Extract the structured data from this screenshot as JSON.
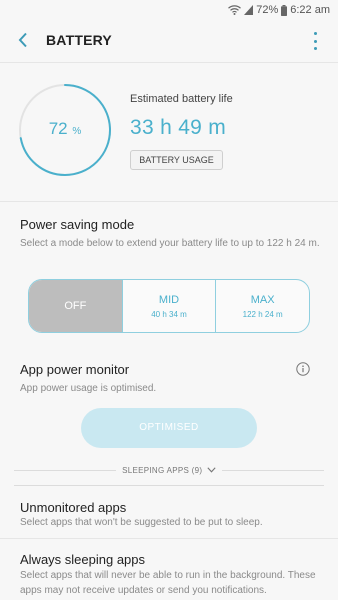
{
  "status_bar": {
    "battery_percent": "72%",
    "time": "6:22 am"
  },
  "app_bar": {
    "title": "BATTERY"
  },
  "summary": {
    "ring_value": "72",
    "ring_unit": "%",
    "battery_level_fraction": 0.72,
    "estimated_label": "Estimated battery life",
    "estimated_value": "33 h 49 m",
    "usage_button_label": "BATTERY USAGE"
  },
  "power_saving": {
    "title": "Power saving mode",
    "description": "Select a mode below to extend your battery life to up to 122 h 24 m.",
    "modes": [
      {
        "name": "OFF",
        "time": ""
      },
      {
        "name": "MID",
        "time": "40 h 34 m"
      },
      {
        "name": "MAX",
        "time": "122 h 24 m"
      }
    ],
    "selected": "OFF"
  },
  "app_power_monitor": {
    "title": "App power monitor",
    "description": "App power usage is optimised.",
    "button_label": "OPTIMISED"
  },
  "sleeping_apps": {
    "header": "SLEEPING APPS (9)"
  },
  "unmonitored": {
    "title": "Unmonitored apps",
    "description": "Select apps that won't be suggested to be put to sleep."
  },
  "always_sleeping": {
    "title": "Always sleeping apps",
    "description": "Select apps that will never be able to run in the background. These apps may not receive updates or send you notifications."
  },
  "colors": {
    "accent": "#4ab0cc",
    "selected_mode": "#bdbdbd",
    "button_disabled": "#c9e8f1"
  }
}
